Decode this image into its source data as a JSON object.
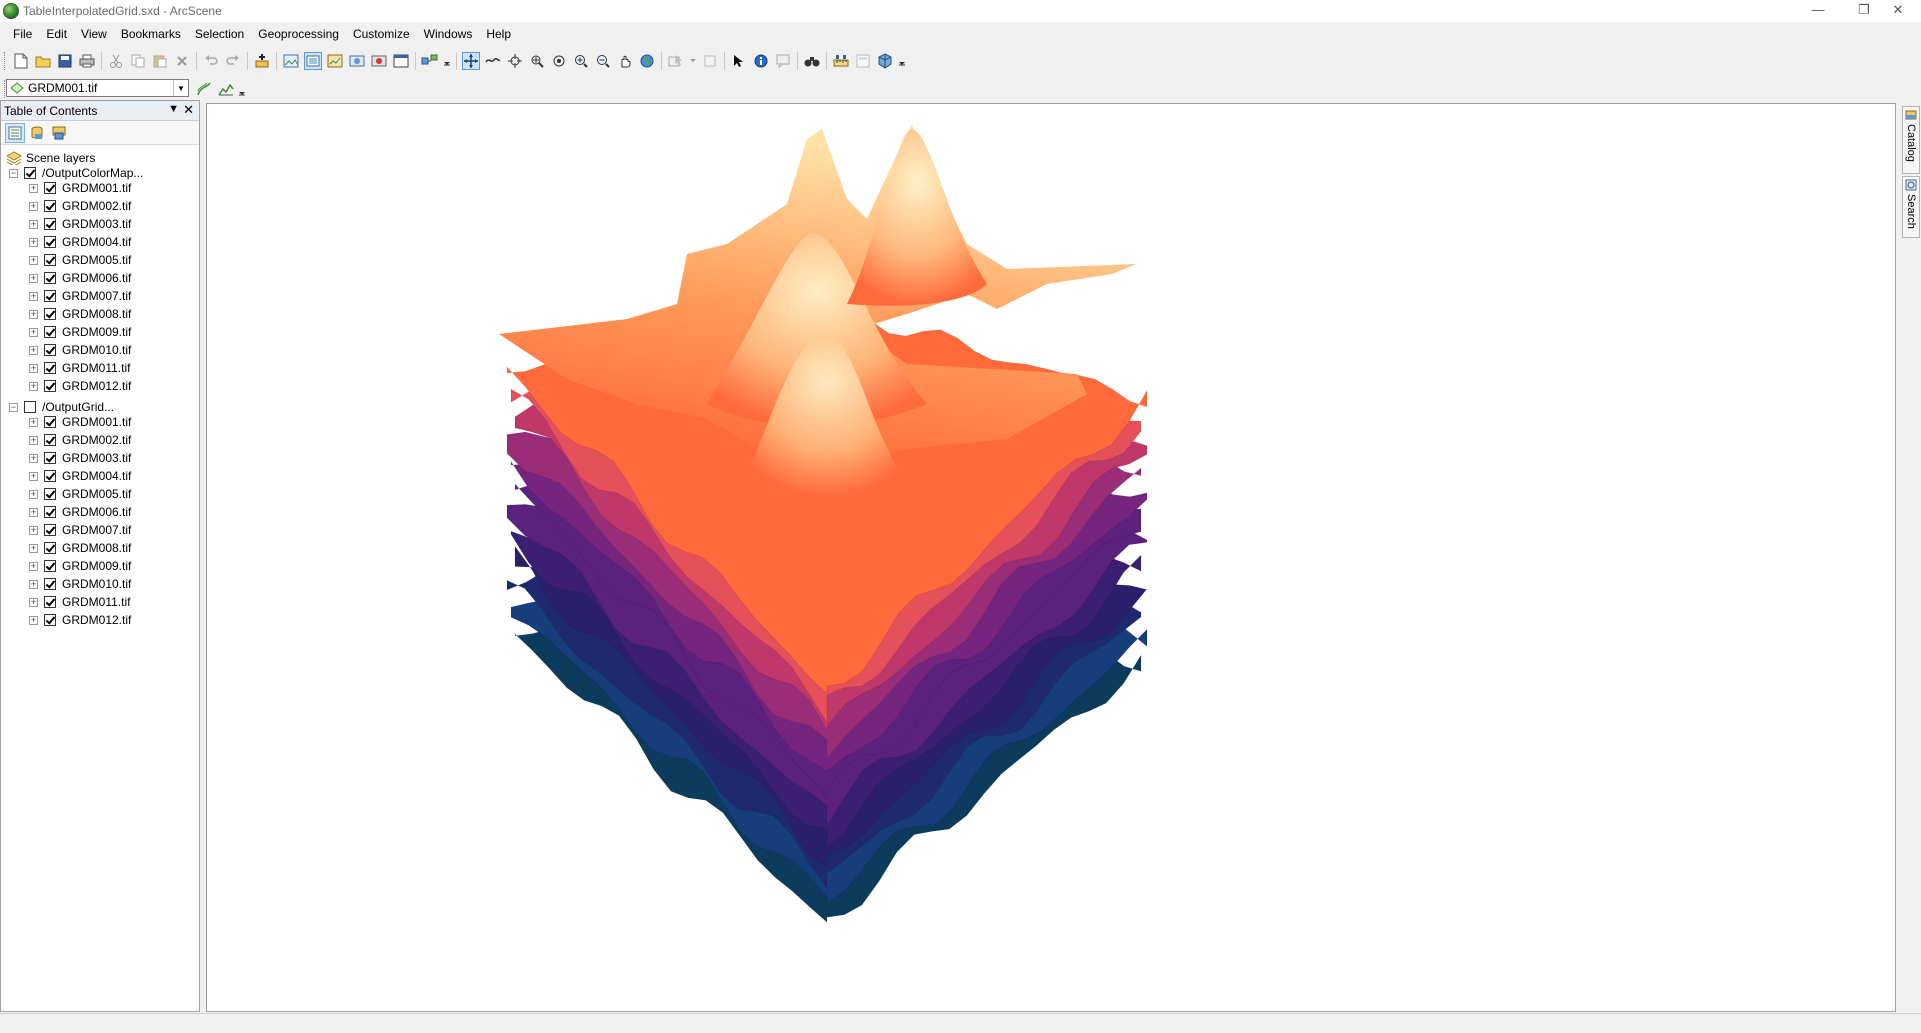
{
  "window": {
    "title": "TableInterpolatedGrid.sxd - ArcScene"
  },
  "menu": [
    "File",
    "Edit",
    "View",
    "Bookmarks",
    "Selection",
    "Geoprocessing",
    "Customize",
    "Windows",
    "Help"
  ],
  "layer_combo": {
    "value": "GRDM001.tif"
  },
  "toc": {
    "title": "Table of Contents",
    "root": "Scene layers",
    "groups": [
      {
        "name": "/OutputColorMap...",
        "checked": true,
        "layers": [
          "GRDM001.tif",
          "GRDM002.tif",
          "GRDM003.tif",
          "GRDM004.tif",
          "GRDM005.tif",
          "GRDM006.tif",
          "GRDM007.tif",
          "GRDM008.tif",
          "GRDM009.tif",
          "GRDM010.tif",
          "GRDM011.tif",
          "GRDM012.tif"
        ]
      },
      {
        "name": "/OutputGrid...",
        "checked": false,
        "layers": [
          "GRDM001.tif",
          "GRDM002.tif",
          "GRDM003.tif",
          "GRDM004.tif",
          "GRDM005.tif",
          "GRDM006.tif",
          "GRDM007.tif",
          "GRDM008.tif",
          "GRDM009.tif",
          "GRDM010.tif",
          "GRDM011.tif",
          "GRDM012.tif"
        ]
      }
    ]
  },
  "right_dock": {
    "catalog": "Catalog",
    "search": "Search"
  },
  "colors": {
    "layer_palette": [
      "#0d3b5e",
      "#163e7a",
      "#1f2a6e",
      "#2a1f6a",
      "#3b1f73",
      "#5a217d",
      "#76257f",
      "#9a2d78",
      "#c0386a",
      "#e5505a",
      "#ff6a3d",
      "#ff8a4a",
      "#ffb870",
      "#ffe4a8"
    ],
    "accent": "#5b9bd5"
  }
}
